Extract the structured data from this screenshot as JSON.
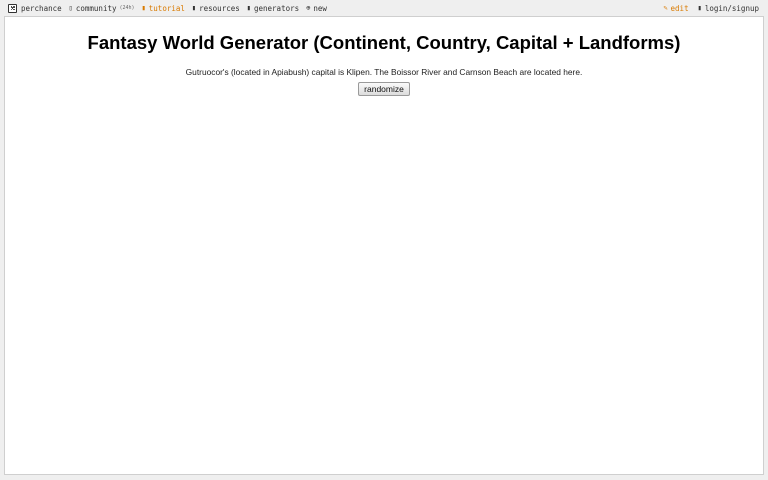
{
  "nav": {
    "logo_label": "perchance",
    "community_label": "community",
    "community_count": "(24h)",
    "tutorial_label": "tutorial",
    "resources_label": "resources",
    "generators_label": "generators",
    "new_label": "new",
    "edit_label": "edit",
    "login_label": "login/signup"
  },
  "icons": {
    "logo": "dice-icon",
    "community": "chat-icon",
    "tutorial": "book-icon",
    "resources": "folder-icon",
    "generators": "list-icon",
    "new": "plus-circle-icon",
    "edit": "pencil-icon",
    "login": "user-icon"
  },
  "colors": {
    "accent": "#d97a00",
    "background": "#efefef",
    "panel": "#ffffff"
  },
  "page": {
    "title": "Fantasy World Generator (Continent, Country, Capital + Landforms)",
    "output": "Gutruocor's (located in Apiabush) capital is Klipen. The Boissor River and Carnson Beach are located here.",
    "button_label": "randomize"
  }
}
